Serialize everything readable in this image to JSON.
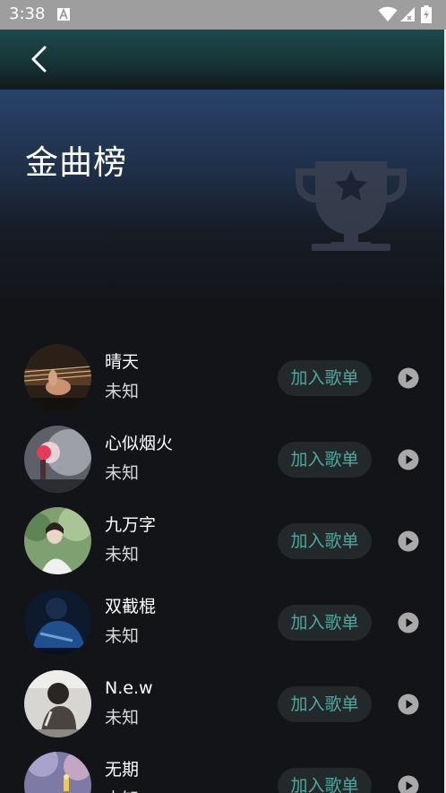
{
  "status_bar": {
    "time": "3:38"
  },
  "header": {
    "title": "金曲榜"
  },
  "songs": [
    {
      "title": "晴天",
      "artist": "未知",
      "add_label": "加入歌单"
    },
    {
      "title": "心似烟火",
      "artist": "未知",
      "add_label": "加入歌单"
    },
    {
      "title": "九万字",
      "artist": "未知",
      "add_label": "加入歌单"
    },
    {
      "title": "双截棍",
      "artist": "未知",
      "add_label": "加入歌单"
    },
    {
      "title": "N.e.w",
      "artist": "未知",
      "add_label": "加入歌单"
    },
    {
      "title": "无期",
      "artist": "未知",
      "add_label": "加入歌单"
    }
  ],
  "colors": {
    "background": "#131418",
    "accent_text": "#4fa79e",
    "button_bg": "#23292b",
    "status_bar": "#9e9e9e"
  },
  "icons": [
    "back-arrow-icon",
    "trophy-icon",
    "play-circle-icon",
    "wifi-icon",
    "signal-icon",
    "battery-icon"
  ]
}
